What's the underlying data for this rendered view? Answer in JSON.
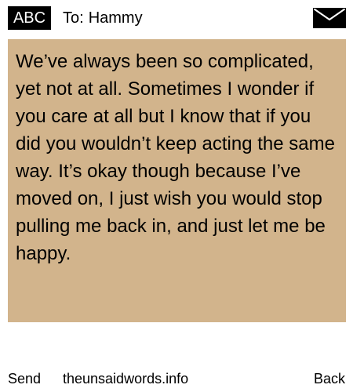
{
  "header": {
    "badge_label": "ABC",
    "to_label": "To:",
    "recipient": "Hammy",
    "mail_icon": "envelope-icon"
  },
  "message": {
    "text": "We’ve always been so complicated, yet not at all. Sometimes I wonder if you care at all but I know that if you did you wouldn’t keep acting the same way. It’s okay though because I’ve moved on, I just wish you would stop pulling me back in, and just let me be happy.",
    "background_color": "#d2b48c"
  },
  "footer": {
    "send_label": "Send",
    "site_label": "theunsaidwords.info",
    "back_label": "Back"
  }
}
